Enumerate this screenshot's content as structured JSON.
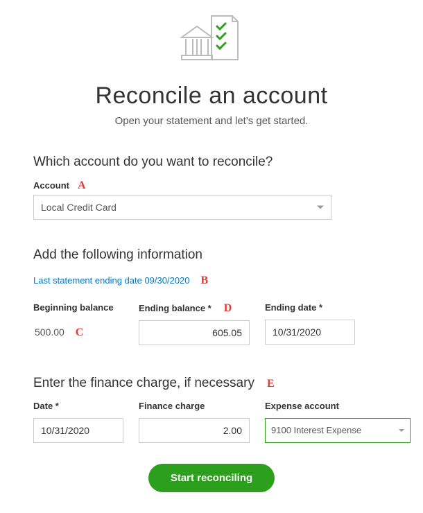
{
  "header": {
    "title": "Reconcile an account",
    "subtitle": "Open your statement and let's get started."
  },
  "annotations": {
    "A": "A",
    "B": "B",
    "C": "C",
    "D": "D",
    "E": "E"
  },
  "account": {
    "question": "Which account do you want to reconcile?",
    "label": "Account",
    "selected": "Local Credit Card"
  },
  "info": {
    "heading": "Add the following information",
    "last_stmt": "Last statement ending date 09/30/2020",
    "beginning_balance_label": "Beginning balance",
    "beginning_balance": "500.00",
    "ending_balance_label": "Ending balance *",
    "ending_balance": "605.05",
    "ending_date_label": "Ending date *",
    "ending_date": "10/31/2020"
  },
  "finance": {
    "heading": "Enter the finance charge, if necessary",
    "date_label": "Date *",
    "date": "10/31/2020",
    "charge_label": "Finance charge",
    "charge": "2.00",
    "expense_label": "Expense account",
    "expense_selected": "9100 Interest Expense"
  },
  "actions": {
    "start": "Start reconciling"
  }
}
